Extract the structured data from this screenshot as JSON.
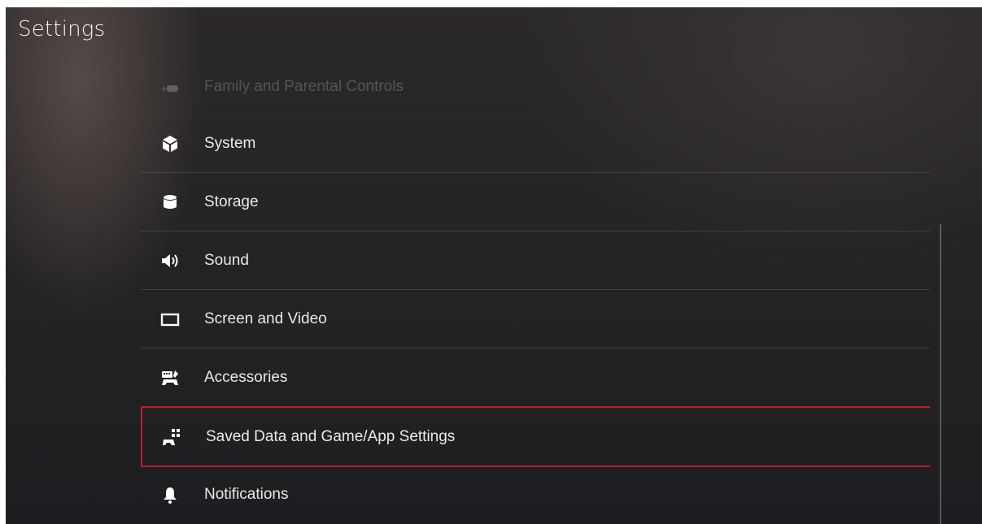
{
  "header": {
    "title": "Settings"
  },
  "menu": {
    "items": [
      {
        "label": "Family and Parental Controls",
        "icon": "family-icon"
      },
      {
        "label": "System",
        "icon": "cube-icon"
      },
      {
        "label": "Storage",
        "icon": "storage-icon"
      },
      {
        "label": "Sound",
        "icon": "speaker-icon"
      },
      {
        "label": "Screen and Video",
        "icon": "screen-icon"
      },
      {
        "label": "Accessories",
        "icon": "accessories-icon"
      },
      {
        "label": "Saved Data and Game/App Settings",
        "icon": "saved-data-icon"
      },
      {
        "label": "Notifications",
        "icon": "bell-icon"
      }
    ],
    "selected_index": 6
  },
  "colors": {
    "highlight": "#c21d2a",
    "text": "#e9e9e9",
    "background": "#242224"
  }
}
